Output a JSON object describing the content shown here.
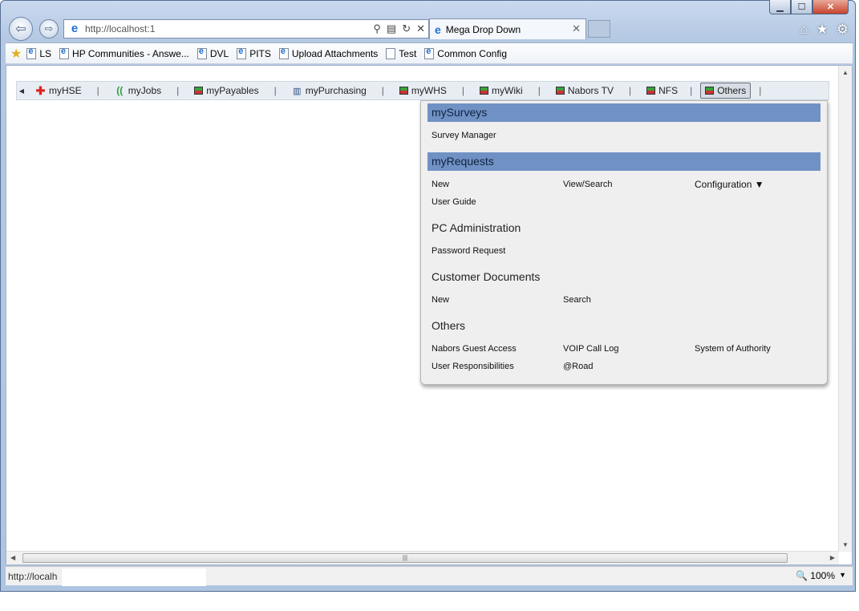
{
  "window": {
    "buttons": {
      "minimize": "▁",
      "maximize": "☐",
      "close": "✕"
    }
  },
  "navigation": {
    "back_icon": "back-arrow-icon",
    "forward_icon": "forward-arrow-icon",
    "address": "http://localhost:1",
    "tab_title": "Mega Drop Down",
    "tab_close": "✕"
  },
  "favorites": {
    "items": [
      {
        "label": "LS",
        "icon": "ie"
      },
      {
        "label": "HP Communities - Answe...",
        "icon": "ie"
      },
      {
        "label": "DVL",
        "icon": "ie"
      },
      {
        "label": "PITS",
        "icon": "ie"
      },
      {
        "label": "Upload Attachments",
        "icon": "ie"
      },
      {
        "label": "Test",
        "icon": "page"
      },
      {
        "label": "Common Config",
        "icon": "ie"
      }
    ]
  },
  "menubar": {
    "items": [
      {
        "label": "myHSE",
        "icon": "cross"
      },
      {
        "label": "myJobs",
        "icon": "jobs"
      },
      {
        "label": "myPayables",
        "icon": "box"
      },
      {
        "label": "myPurchasing",
        "icon": "building"
      },
      {
        "label": "myWHS",
        "icon": "box"
      },
      {
        "label": "myWiki",
        "icon": "box"
      },
      {
        "label": "Nabors TV",
        "icon": "box"
      },
      {
        "label": "NFS",
        "icon": "box"
      },
      {
        "label": "Others",
        "icon": "box",
        "active": true
      }
    ]
  },
  "dropdown": {
    "surveys_heading": "mySurveys",
    "survey_manager": "Survey Manager",
    "requests_heading": "myRequests",
    "req_new": "New",
    "req_view": "View/Search",
    "req_config": "Configuration ▼",
    "req_guide": "User Guide",
    "pc_heading": "PC Administration",
    "pc_password": "Password Request",
    "cust_heading": "Customer Documents",
    "cust_new": "New",
    "cust_search": "Search",
    "others_heading": "Others",
    "others_guest": "Nabors Guest Access",
    "others_voip": "VOIP Call Log",
    "others_authority": "System of Authority",
    "others_resp": "User Responsibilities",
    "others_road": "@Road"
  },
  "status": {
    "url": "http://localh",
    "zoom": "100%"
  }
}
